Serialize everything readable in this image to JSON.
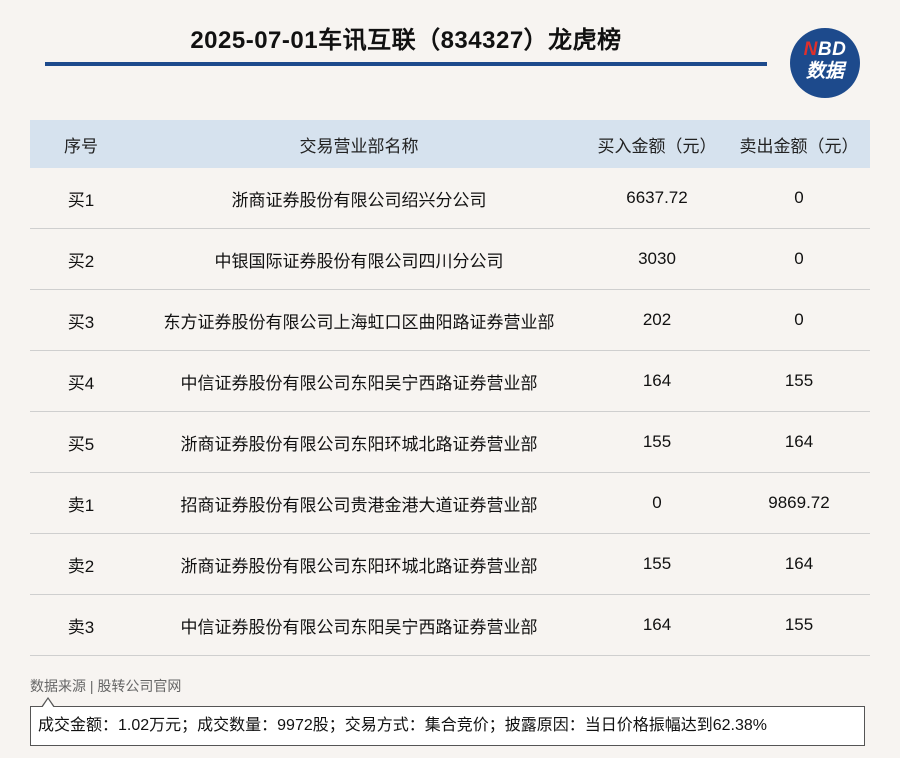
{
  "title": "2025-07-01车讯互联（834327）龙虎榜",
  "logo": {
    "line1_n": "N",
    "line1_rest": "BD",
    "line2": "数据"
  },
  "colors": {
    "brand_blue": "#1d4a8c",
    "header_bg": "#d6e2ee",
    "page_bg": "#f7f4f1",
    "logo_accent": "#e0302c"
  },
  "table": {
    "headers": [
      "序号",
      "交易营业部名称",
      "买入金额（元）",
      "卖出金额（元）"
    ],
    "rows": [
      [
        "买1",
        "浙商证券股份有限公司绍兴分公司",
        "6637.72",
        "0"
      ],
      [
        "买2",
        "中银国际证券股份有限公司四川分公司",
        "3030",
        "0"
      ],
      [
        "买3",
        "东方证券股份有限公司上海虹口区曲阳路证券营业部",
        "202",
        "0"
      ],
      [
        "买4",
        "中信证券股份有限公司东阳吴宁西路证券营业部",
        "164",
        "155"
      ],
      [
        "买5",
        "浙商证券股份有限公司东阳环城北路证券营业部",
        "155",
        "164"
      ],
      [
        "卖1",
        "招商证券股份有限公司贵港金港大道证券营业部",
        "0",
        "9869.72"
      ],
      [
        "卖2",
        "浙商证券股份有限公司东阳环城北路证券营业部",
        "155",
        "164"
      ],
      [
        "卖3",
        "中信证券股份有限公司东阳吴宁西路证券营业部",
        "164",
        "155"
      ]
    ]
  },
  "source": "数据来源 | 股转公司官网",
  "note": "成交金额：1.02万元；成交数量：9972股；交易方式：集合竞价；披露原因：当日价格振幅达到62.38%"
}
